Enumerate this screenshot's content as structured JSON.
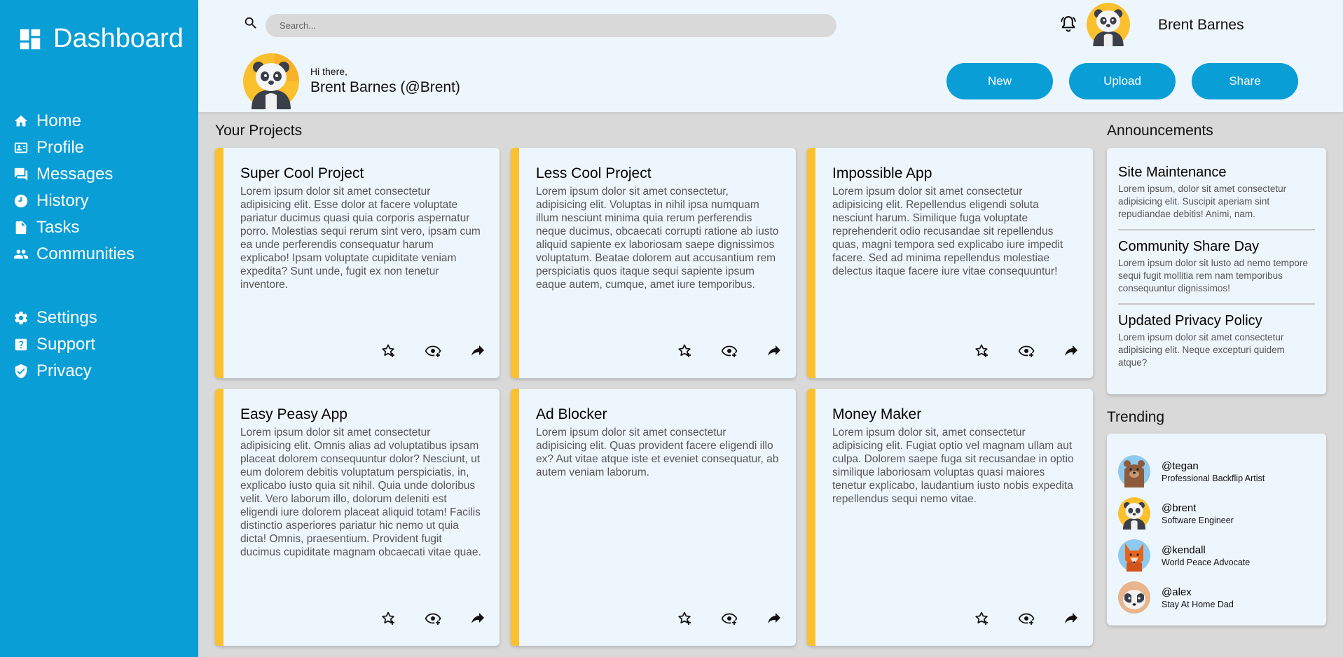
{
  "sidebar": {
    "brand": "Dashboard",
    "items": [
      {
        "label": "Home",
        "icon": "home-icon"
      },
      {
        "label": "Profile",
        "icon": "profile-card-icon"
      },
      {
        "label": "Messages",
        "icon": "chat-icon"
      },
      {
        "label": "History",
        "icon": "clock-icon"
      },
      {
        "label": "Tasks",
        "icon": "document-icon"
      },
      {
        "label": "Communities",
        "icon": "people-icon"
      }
    ],
    "secondary": [
      {
        "label": "Settings",
        "icon": "gear-icon"
      },
      {
        "label": "Support",
        "icon": "help-icon"
      },
      {
        "label": "Privacy",
        "icon": "shield-icon"
      }
    ]
  },
  "header": {
    "search_placeholder": "Search...",
    "user_name": "Brent Barnes",
    "greeting_small": "Hi there,",
    "greeting_name": "Brent Barnes (@Brent)",
    "buttons": {
      "new": "New",
      "upload": "Upload",
      "share": "Share"
    }
  },
  "projects": {
    "title": "Your Projects",
    "items": [
      {
        "title": "Super Cool Project",
        "body": "Lorem ipsum dolor sit amet consectetur adipisicing elit. Esse dolor at facere voluptate pariatur ducimus quasi quia corporis aspernatur porro. Molestias sequi rerum sint vero, ipsam cum ea unde perferendis consequatur harum explicabo! Ipsam voluptate cupiditate veniam expedita? Sunt unde, fugit ex non tenetur inventore."
      },
      {
        "title": "Less Cool Project",
        "body": "Lorem ipsum dolor sit amet consectetur, adipisicing elit. Voluptas in nihil ipsa numquam illum nesciunt minima quia rerum perferendis neque ducimus, obcaecati corrupti ratione ab iusto aliquid sapiente ex laboriosam saepe dignissimos voluptatum. Beatae dolorem aut accusantium rem perspiciatis quos itaque sequi sapiente ipsum eaque autem, cumque, amet iure temporibus."
      },
      {
        "title": "Impossible App",
        "body": "Lorem ipsum dolor sit amet consectetur adipisicing elit. Repellendus eligendi soluta nesciunt harum. Similique fuga voluptate reprehenderit odio recusandae sit repellendus quas, magni tempora sed explicabo iure impedit facere. Sed ad minima repellendus molestiae delectus itaque facere iure vitae consequuntur!"
      },
      {
        "title": "Easy Peasy App",
        "body": "Lorem ipsum dolor sit amet consectetur adipisicing elit. Omnis alias ad voluptatibus ipsam placeat dolorem consequuntur dolor? Nesciunt, ut eum dolorem debitis voluptatum perspiciatis, in, explicabo iusto quia sit nihil. Quia unde doloribus velit. Vero laborum illo, dolorum deleniti est eligendi iure dolorem placeat aliquid totam! Facilis distinctio asperiores pariatur hic nemo ut quia dicta! Omnis, praesentium. Provident fugit ducimus cupiditate magnam obcaecati vitae quae."
      },
      {
        "title": "Ad Blocker",
        "body": "Lorem ipsum dolor sit amet consectetur adipisicing elit. Quas provident facere eligendi illo ex? Aut vitae atque iste et eveniet consequatur, ab autem veniam laborum."
      },
      {
        "title": "Money Maker",
        "body": "Lorem ipsum dolor sit, amet consectetur adipisicing elit. Fugiat optio vel magnam ullam aut culpa. Dolorem saepe fuga sit recusandae in optio similique laboriosam voluptas quasi maiores tenetur explicabo, laudantium iusto nobis expedita repellendus sequi nemo vitae."
      }
    ],
    "actions": [
      "star-add-icon",
      "watch-icon",
      "share-icon"
    ]
  },
  "announcements": {
    "title": "Announcements",
    "items": [
      {
        "title": "Site Maintenance",
        "body": "Lorem ipsum, dolor sit amet consectetur adipisicing elit. Suscipit aperiam sint repudiandae debitis! Animi, nam."
      },
      {
        "title": "Community Share Day",
        "body": "Lorem ipsum dolor sit lusto ad nemo tempore sequi fugit mollitia rem nam temporibus consequuntur dignissimos!"
      },
      {
        "title": "Updated Privacy Policy",
        "body": "Lorem ipsum dolor sit amet consectetur adipisicing elit. Neque excepturi quidem atque?"
      }
    ]
  },
  "trending": {
    "title": "Trending",
    "items": [
      {
        "handle": "@tegan",
        "role": "Professional Backflip Artist",
        "avatar": "bear"
      },
      {
        "handle": "@brent",
        "role": "Software Engineer",
        "avatar": "panda"
      },
      {
        "handle": "@kendall",
        "role": "World Peace Advocate",
        "avatar": "fox"
      },
      {
        "handle": "@alex",
        "role": "Stay At Home Dad",
        "avatar": "badger"
      }
    ]
  },
  "colors": {
    "primary": "#0a9ed6",
    "accent": "#fbc02d",
    "card": "#eef6fd",
    "background": "#d9d9d9"
  }
}
